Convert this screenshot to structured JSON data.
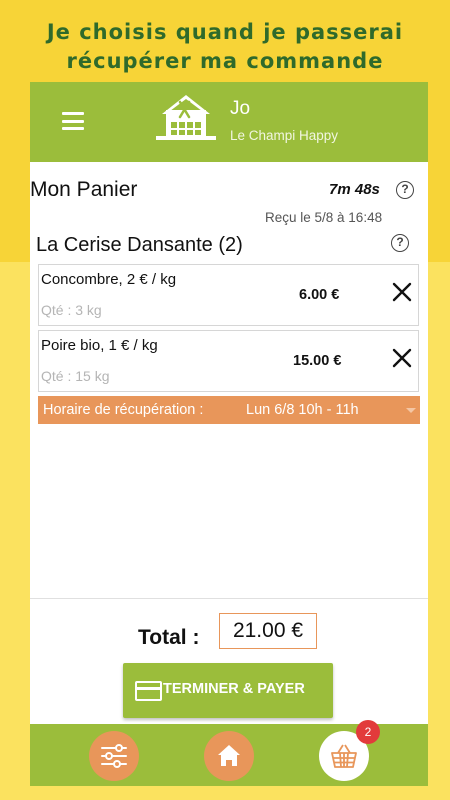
{
  "headline": {
    "line1": "Je choisis quand je passerai",
    "line2": "récupérer ma commande"
  },
  "appbar": {
    "title": "Jo",
    "subtitle": "Le Champi Happy"
  },
  "cart": {
    "title": "Mon Panier",
    "timer": "7m 48s",
    "help_glyph": "?",
    "received": "Reçu le 5/8 à 16:48"
  },
  "shop": {
    "name": "La Cerise Dansante (2)",
    "help_glyph": "?"
  },
  "items": [
    {
      "name": "Concombre, 2 € / kg",
      "qty": "Qté : 3 kg",
      "price": "6.00 €"
    },
    {
      "name": "Poire bio, 1 € / kg",
      "qty": "Qté : 15 kg",
      "price": "15.00 €"
    }
  ],
  "pickup": {
    "label": "Horaire de récupération :",
    "value": "Lun 6/8 10h - 11h"
  },
  "total": {
    "label": "Total :",
    "value": "21.00 €"
  },
  "pay_button": {
    "label": "TERMINER & PAYER",
    "icon": "credit-card-icon"
  },
  "bottom_nav": {
    "filters_icon": "sliders-icon",
    "home_icon": "home-icon",
    "basket_icon": "basket-icon",
    "basket_badge": "2"
  },
  "colors": {
    "background_yellow": "#f7d437",
    "headline_green": "#2f6a2b",
    "app_green": "#9bbd3b",
    "accent_orange": "#e8965a",
    "badge_red": "#e23b3b"
  }
}
